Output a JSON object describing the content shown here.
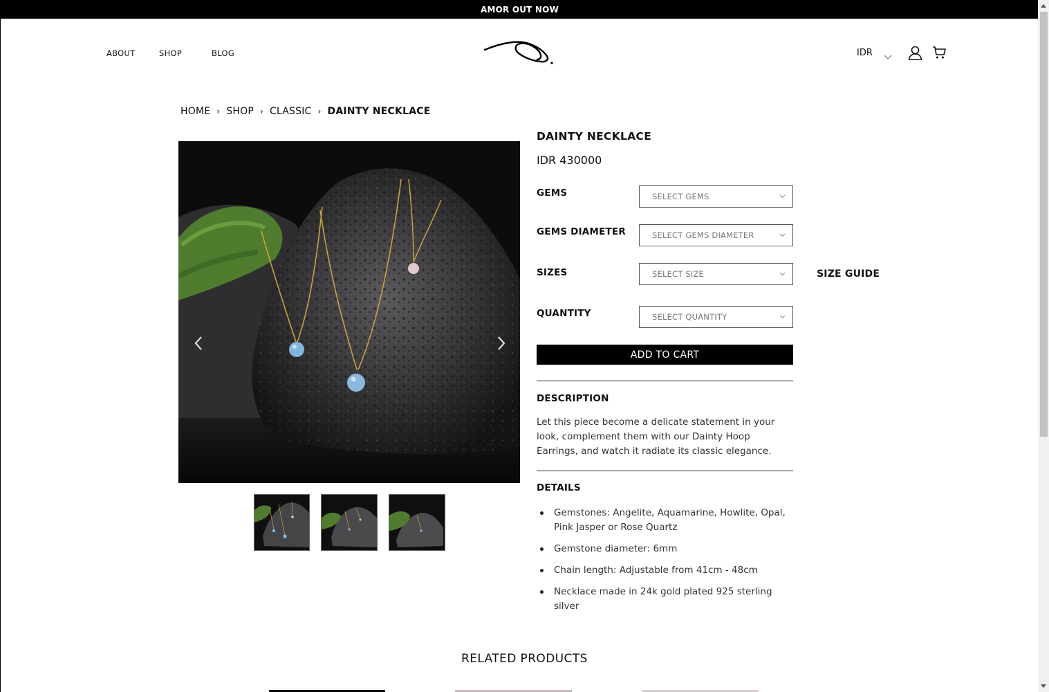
{
  "announcement": "AMOR OUT NOW",
  "nav": {
    "about": "ABOUT",
    "shop": "SHOP",
    "blog": "BLOG"
  },
  "header": {
    "currency": "IDR"
  },
  "breadcrumb": [
    "HOME",
    "SHOP",
    "CLASSIC",
    "DAINTY NECKLACE"
  ],
  "product": {
    "title": "DAINTY NECKLACE",
    "price": "IDR 430000",
    "options": {
      "gems_label": "GEMS",
      "gems_placeholder": "SELECT GEMS",
      "diameter_label": "GEMS DIAMETER",
      "diameter_placeholder": "SELECT GEMS DIAMETER",
      "sizes_label": "SIZES",
      "sizes_placeholder": "SELECT SIZE",
      "quantity_label": "QUANTITY",
      "quantity_placeholder": "SELECT QUANTITY"
    },
    "size_guide": "SIZE GUIDE",
    "add_to_cart": "ADD TO CART",
    "description_title": "DESCRIPTION",
    "description": "Let this piece become a delicate statement in your look, complement them with our Dainty Hoop Earrings, and watch it radiate its classic elegance.",
    "details_title": "DETAILS",
    "details": [
      "Gemstones: Angelite, Aquamarine, Howlite, Opal, Pink Jasper or Rose Quartz",
      "Gemstone diameter: 6mm",
      "Chain length: Adjustable from 41cm - 48cm",
      "Necklace made in 24k gold plated 925 sterling silver"
    ]
  },
  "related_title": "RELATED PRODUCTS",
  "colors": {
    "accent": "#000000",
    "text": "#111111",
    "muted": "#777777"
  }
}
